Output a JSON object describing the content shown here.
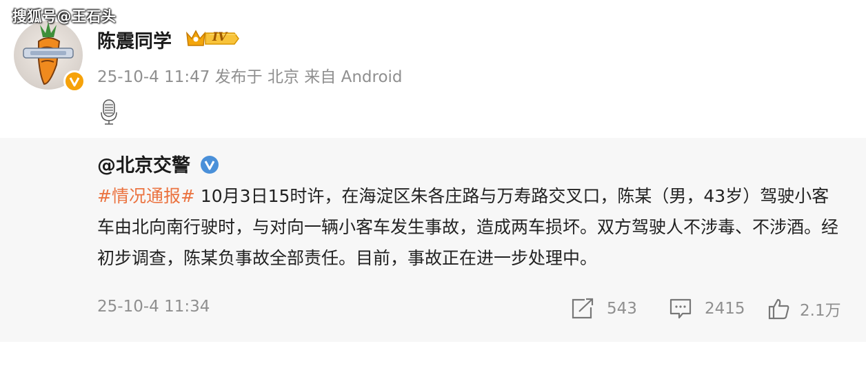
{
  "watermark": "搜狐号@王石头",
  "post": {
    "author": "陈震同学",
    "level_badge": "IV",
    "meta": "25-10-4 11:47 发布于 北京 来自 Android",
    "verify_badge_letter": "V",
    "icons": [
      "verified-orange-icon",
      "crown-icon",
      "microphone-icon"
    ]
  },
  "repost": {
    "author": "@北京交警",
    "hashtag": "#情况通报#",
    "content": " 10月3日15时许，在海淀区朱各庄路与万寿路交叉口，陈某（男，43岁）驾驶小客车由北向南行驶时，与对向一辆小客车发生事故，造成两车损坏。双方驾驶人不涉毒、不涉酒。经初步调查，陈某负事故全部责任。目前，事故正在进一步处理中。",
    "time": "25-10-4 11:34",
    "actions": {
      "repost_count": "543",
      "comment_count": "2415",
      "like_count": "2.1万"
    },
    "icons": [
      "verified-blue-icon",
      "repost-icon",
      "comment-icon",
      "like-icon"
    ]
  },
  "colors": {
    "hashtag": "#eb7340",
    "verified_orange": "#f6a20a",
    "verified_blue": "#4a90d9",
    "meta_gray": "#8f8f8f",
    "repost_background": "#f7f7f7"
  }
}
